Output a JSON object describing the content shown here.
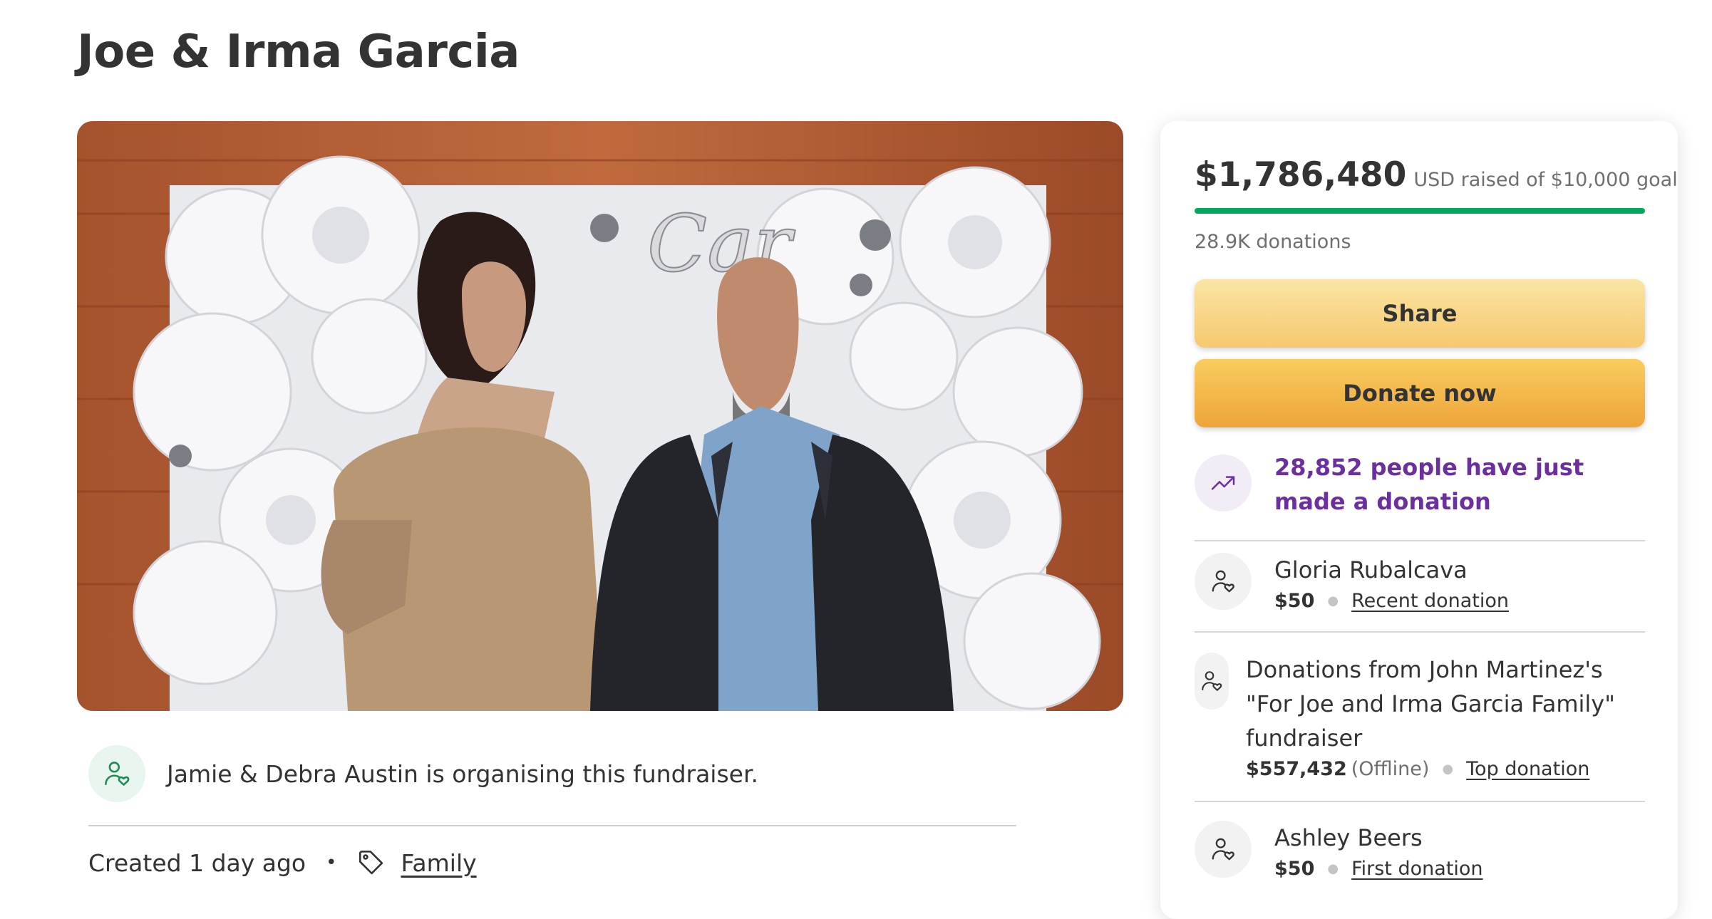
{
  "page": {
    "title": "Joe & Irma Garcia"
  },
  "organizer": {
    "text": "Jamie & Debra Austin is organising this fundraiser."
  },
  "meta": {
    "created": "Created 1 day ago",
    "separator": "•",
    "category": "Family"
  },
  "summary": {
    "amount": "$1,786,480",
    "goal_text": "USD raised of $10,000 goal",
    "progress_fraction": 1.0,
    "donations_count": "28.9K donations",
    "share_label": "Share",
    "donate_label": "Donate now",
    "trending_text": "28,852 people have just made a donation"
  },
  "donations": [
    {
      "name": "Gloria Rubalcava",
      "amount": "$50",
      "extra": "",
      "tag": "Recent donation"
    },
    {
      "name": "Donations from John Martinez's \"For Joe and Irma Garcia Family\" fundraiser",
      "amount": "$557,432",
      "extra": "(Offline)",
      "tag": "Top donation"
    },
    {
      "name": "Ashley Beers",
      "amount": "$50",
      "extra": "",
      "tag": "First donation"
    }
  ],
  "colors": {
    "accent_green": "#02a95c",
    "trend_purple": "#6b2fa0",
    "donate_orange": "#eea53a",
    "share_yellow": "#f5c96e"
  },
  "icons": {
    "organizer": "user-heart-icon",
    "tag": "tag-icon",
    "trend": "trending-up-icon",
    "donor": "user-heart-icon"
  }
}
